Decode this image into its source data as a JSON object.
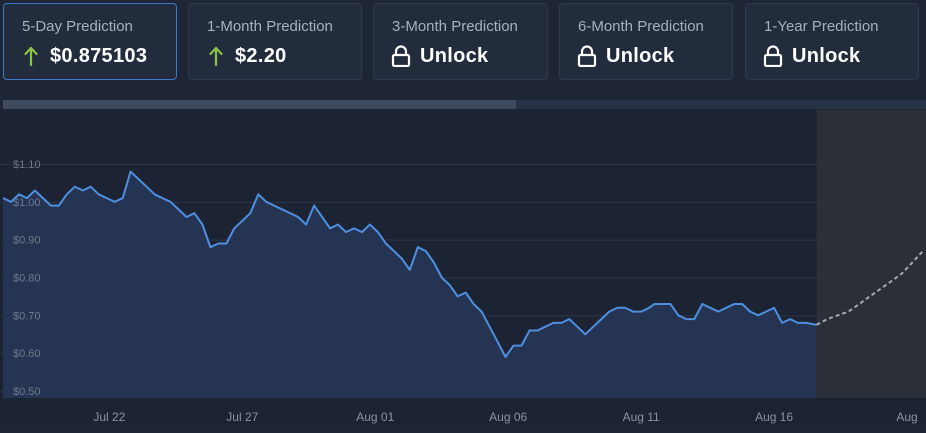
{
  "cards": [
    {
      "label": "5-Day Prediction",
      "value": "$0.875103",
      "icon": "arrow-up-icon",
      "active": true
    },
    {
      "label": "1-Month Prediction",
      "value": "$2.20",
      "icon": "arrow-up-icon",
      "active": false
    },
    {
      "label": "3-Month Prediction",
      "value": "Unlock",
      "icon": "lock-icon",
      "active": false
    },
    {
      "label": "6-Month Prediction",
      "value": "Unlock",
      "icon": "lock-icon",
      "active": false
    },
    {
      "label": "1-Year Prediction",
      "value": "Unlock",
      "icon": "lock-icon",
      "active": false
    }
  ],
  "colors": {
    "accent_up": "#8bc34a",
    "line": "#4f8fe0",
    "prediction_line": "#a9a9a9",
    "active_border": "#3d79c7"
  },
  "chart_data": {
    "type": "line",
    "y_ticks": [
      "$1.10",
      "$1.00",
      "$0.90",
      "$0.80",
      "$0.70",
      "$0.60",
      "$0.50"
    ],
    "y_values": [
      1.1,
      1.0,
      0.9,
      0.8,
      0.7,
      0.6,
      0.5
    ],
    "ylim": [
      0.475,
      1.14
    ],
    "x_ticks": [
      "Jul 22",
      "Jul 27",
      "Aug 01",
      "Aug 06",
      "Aug 11",
      "Aug 16",
      "Aug"
    ],
    "x_tick_days": [
      4,
      9,
      14,
      19,
      24,
      29,
      34
    ],
    "x_day_range": [
      0,
      34.6
    ],
    "grid": true,
    "series": [
      {
        "kind": "historical",
        "points": [
          [
            0,
            1.01
          ],
          [
            0.3,
            1.0
          ],
          [
            0.6,
            1.02
          ],
          [
            0.9,
            1.01
          ],
          [
            1.2,
            1.03
          ],
          [
            1.5,
            1.01
          ],
          [
            1.8,
            0.99
          ],
          [
            2.1,
            0.99
          ],
          [
            2.4,
            1.02
          ],
          [
            2.7,
            1.04
          ],
          [
            3.0,
            1.03
          ],
          [
            3.3,
            1.04
          ],
          [
            3.6,
            1.02
          ],
          [
            3.9,
            1.01
          ],
          [
            4.2,
            1.0
          ],
          [
            4.5,
            1.01
          ],
          [
            4.8,
            1.08
          ],
          [
            5.1,
            1.06
          ],
          [
            5.4,
            1.04
          ],
          [
            5.7,
            1.02
          ],
          [
            6.0,
            1.01
          ],
          [
            6.3,
            1.0
          ],
          [
            6.6,
            0.98
          ],
          [
            6.9,
            0.96
          ],
          [
            7.2,
            0.97
          ],
          [
            7.5,
            0.94
          ],
          [
            7.8,
            0.88
          ],
          [
            8.1,
            0.89
          ],
          [
            8.4,
            0.89
          ],
          [
            8.7,
            0.93
          ],
          [
            9.0,
            0.95
          ],
          [
            9.3,
            0.97
          ],
          [
            9.6,
            1.02
          ],
          [
            9.9,
            1.0
          ],
          [
            10.2,
            0.99
          ],
          [
            10.5,
            0.98
          ],
          [
            10.8,
            0.97
          ],
          [
            11.1,
            0.96
          ],
          [
            11.4,
            0.94
          ],
          [
            11.7,
            0.99
          ],
          [
            12.0,
            0.96
          ],
          [
            12.3,
            0.93
          ],
          [
            12.6,
            0.94
          ],
          [
            12.9,
            0.92
          ],
          [
            13.2,
            0.93
          ],
          [
            13.5,
            0.92
          ],
          [
            13.8,
            0.94
          ],
          [
            14.1,
            0.92
          ],
          [
            14.4,
            0.89
          ],
          [
            14.7,
            0.87
          ],
          [
            15.0,
            0.85
          ],
          [
            15.3,
            0.82
          ],
          [
            15.6,
            0.88
          ],
          [
            15.9,
            0.87
          ],
          [
            16.2,
            0.84
          ],
          [
            16.5,
            0.8
          ],
          [
            16.8,
            0.78
          ],
          [
            17.1,
            0.75
          ],
          [
            17.4,
            0.76
          ],
          [
            17.7,
            0.73
          ],
          [
            18.0,
            0.71
          ],
          [
            18.3,
            0.67
          ],
          [
            18.6,
            0.63
          ],
          [
            18.9,
            0.59
          ],
          [
            19.2,
            0.62
          ],
          [
            19.5,
            0.62
          ],
          [
            19.8,
            0.66
          ],
          [
            20.1,
            0.66
          ],
          [
            20.4,
            0.67
          ],
          [
            20.7,
            0.68
          ],
          [
            21.0,
            0.68
          ],
          [
            21.3,
            0.69
          ],
          [
            21.6,
            0.67
          ],
          [
            21.9,
            0.65
          ],
          [
            22.2,
            0.67
          ],
          [
            22.5,
            0.69
          ],
          [
            22.8,
            0.71
          ],
          [
            23.1,
            0.72
          ],
          [
            23.4,
            0.72
          ],
          [
            23.7,
            0.71
          ],
          [
            24.0,
            0.71
          ],
          [
            24.3,
            0.72
          ],
          [
            24.5,
            0.73
          ],
          [
            24.8,
            0.73
          ],
          [
            25.1,
            0.73
          ],
          [
            25.4,
            0.7
          ],
          [
            25.7,
            0.69
          ],
          [
            26.0,
            0.69
          ],
          [
            26.3,
            0.73
          ],
          [
            26.6,
            0.72
          ],
          [
            26.9,
            0.71
          ],
          [
            27.2,
            0.72
          ],
          [
            27.5,
            0.73
          ],
          [
            27.8,
            0.73
          ],
          [
            28.1,
            0.71
          ],
          [
            28.4,
            0.7
          ],
          [
            28.7,
            0.71
          ],
          [
            29.0,
            0.72
          ],
          [
            29.3,
            0.68
          ],
          [
            29.6,
            0.69
          ],
          [
            29.9,
            0.68
          ],
          [
            30.2,
            0.68
          ],
          [
            30.6,
            0.675
          ]
        ]
      },
      {
        "kind": "prediction",
        "points": [
          [
            30.6,
            0.675
          ],
          [
            31.0,
            0.69
          ],
          [
            31.4,
            0.7
          ],
          [
            31.8,
            0.71
          ],
          [
            32.2,
            0.73
          ],
          [
            32.6,
            0.75
          ],
          [
            33.0,
            0.77
          ],
          [
            33.4,
            0.79
          ],
          [
            33.8,
            0.81
          ],
          [
            34.2,
            0.84
          ],
          [
            34.6,
            0.87
          ]
        ]
      }
    ]
  }
}
